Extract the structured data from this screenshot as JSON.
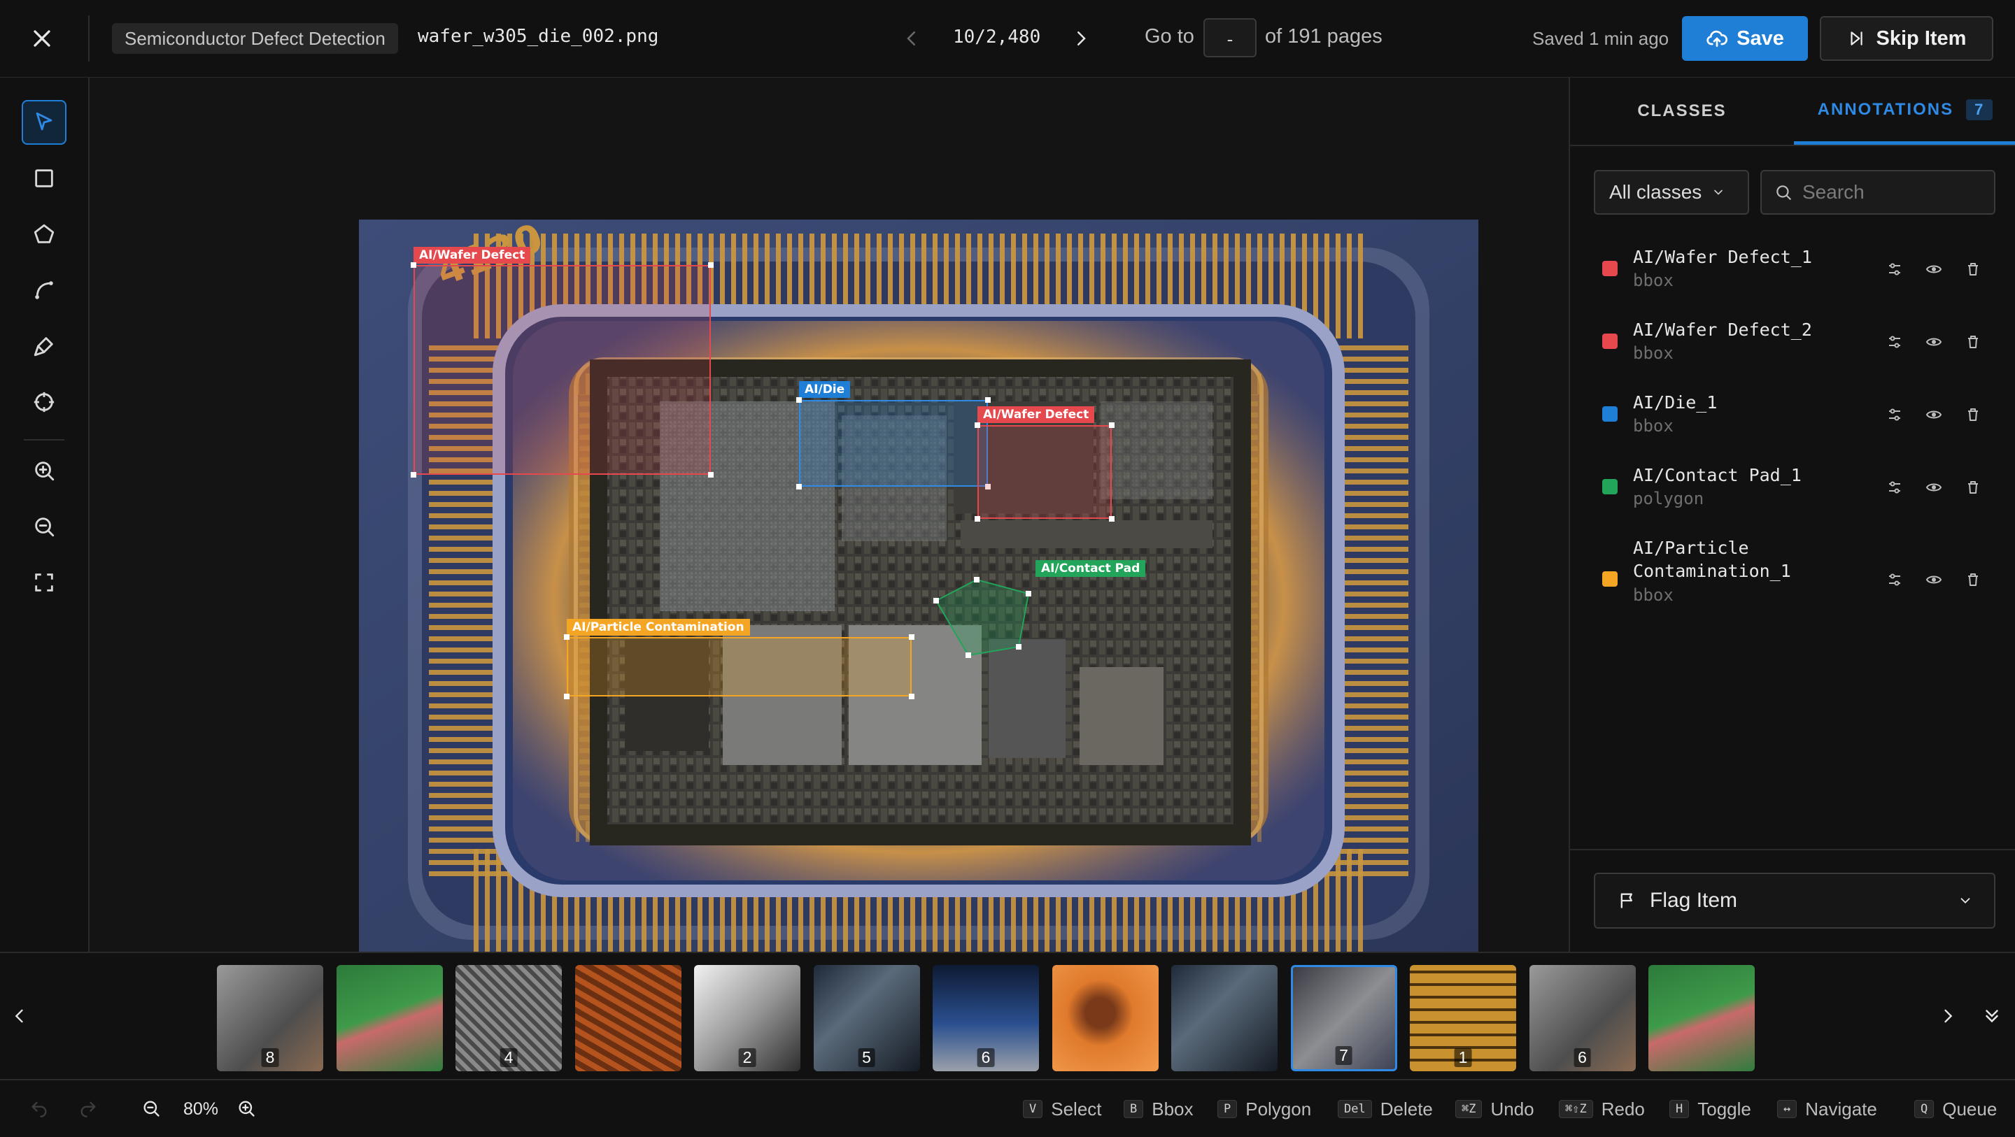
{
  "header": {
    "project": "Semiconductor Defect Detection",
    "filename": "wafer_w305_die_002.png",
    "counter": "10/2,480",
    "goto_label": "Go to",
    "goto_value": "-",
    "pages_label": "of 191 pages",
    "saved": "Saved 1 min ago",
    "save_label": "Save",
    "skip_label": "Skip Item"
  },
  "toolbar": {
    "tools": [
      "select-tool",
      "bbox-tool",
      "polygon-tool",
      "polyline-tool",
      "brush-tool",
      "point-tool",
      "zoom-in-tool",
      "zoom-out-tool",
      "fit-screen-tool"
    ],
    "active": "select-tool"
  },
  "canvas": {
    "labels": [
      {
        "text": "AI/Wafer Defect",
        "color": "#e5484d"
      },
      {
        "text": "AI/Die",
        "color": "#1f7fd6"
      },
      {
        "text": "AI/Wafer Defect",
        "color": "#e5484d"
      },
      {
        "text": "AI/Contact Pad",
        "color": "#22a55a"
      },
      {
        "text": "AI/Particle Contamination",
        "color": "#f5a524"
      }
    ]
  },
  "panel": {
    "tabs": {
      "classes": "CLASSES",
      "annotations": "ANNOTATIONS",
      "count": "7"
    },
    "filter": "All classes",
    "search_placeholder": "Search",
    "annotations": [
      {
        "name": "AI/Wafer Defect_1",
        "type": "bbox",
        "color": "#e5484d"
      },
      {
        "name": "AI/Wafer Defect_2",
        "type": "bbox",
        "color": "#e5484d"
      },
      {
        "name": "AI/Die_1",
        "type": "bbox",
        "color": "#1f7fd6"
      },
      {
        "name": "AI/Contact Pad_1",
        "type": "polygon",
        "color": "#22a55a"
      },
      {
        "name": "AI/Particle Contamination_1",
        "name_line1": "AI/Particle",
        "name_line2": "Contamination_1",
        "type": "bbox",
        "color": "#f5a524"
      }
    ],
    "flag_label": "Flag Item"
  },
  "filmstrip": {
    "thumbs": [
      {
        "num": "8",
        "theme": "chip-on-pad"
      },
      {
        "num": "",
        "theme": "green-circuit"
      },
      {
        "num": "4",
        "theme": "mesh"
      },
      {
        "num": "",
        "theme": "orange-board"
      },
      {
        "num": "2",
        "theme": "microscope"
      },
      {
        "num": "5",
        "theme": "ic-label"
      },
      {
        "num": "6",
        "theme": "blue-chip"
      },
      {
        "num": "",
        "theme": "orange-button"
      },
      {
        "num": "",
        "theme": "ic-label"
      },
      {
        "num": "7",
        "theme": "die",
        "active": true
      },
      {
        "num": "1",
        "theme": "gold-grid"
      },
      {
        "num": "6",
        "theme": "chip-on-pad"
      },
      {
        "num": "",
        "theme": "green-circuit"
      }
    ]
  },
  "status": {
    "zoom": "80%",
    "shortcuts": [
      {
        "key": "V",
        "label": "Select"
      },
      {
        "key": "B",
        "label": "Bbox"
      },
      {
        "key": "P",
        "label": "Polygon"
      },
      {
        "key": "Del",
        "label": "Delete"
      },
      {
        "key": "⌘Z",
        "label": "Undo"
      },
      {
        "key": "⌘⇧Z",
        "label": "Redo"
      },
      {
        "key": "H",
        "label": "Toggle"
      },
      {
        "key": "↔",
        "label": "Navigate"
      },
      {
        "key": "Q",
        "label": "Queue"
      }
    ]
  }
}
